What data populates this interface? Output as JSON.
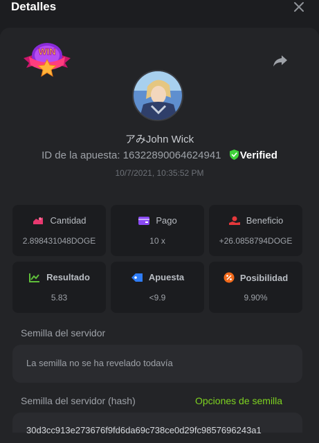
{
  "header": {
    "title": "Detalles"
  },
  "icons": {
    "close": "close-icon",
    "share": "share-icon",
    "logo": "win-badge-icon"
  },
  "logo_text": "WIN",
  "user": {
    "name": "アみJohn Wick",
    "bet_id_label": "ID de la apuesta: 1632289006462494​1",
    "verified": "Verified",
    "timestamp": "10/7/2021, 10:35:52 PM"
  },
  "stats": [
    {
      "label": "Cantidad",
      "value": "2.898431048DOGE",
      "icon": "cantidad-icon",
      "color": "#e8386f"
    },
    {
      "label": "Pago",
      "value": "10 x",
      "icon": "wallet-icon",
      "color": "#8a4af3"
    },
    {
      "label": "Beneficio",
      "value": "+26.0858794DOGE",
      "icon": "beneficio-icon",
      "color": "#e5383b"
    },
    {
      "label": "Resultado",
      "value": "5.83",
      "icon": "resultado-icon",
      "color": "#5fbf3a"
    },
    {
      "label": "Apuesta",
      "value": "<9.9",
      "icon": "tag-icon",
      "color": "#2e7cf6"
    },
    {
      "label": "Posibilidad",
      "value": "9.90%",
      "icon": "percent-icon",
      "color": "#f26a1b"
    }
  ],
  "server_seed": {
    "label": "Semilla del servidor",
    "value": "La semilla no se ha revelado todavía"
  },
  "server_seed_hash": {
    "label": "Semilla del servidor (hash)",
    "options_link": "Opciones de semilla",
    "value": "30d3cc913e273676f9fd6da69c738ce0d29fc9857696243a1"
  },
  "colors": {
    "accent_green": "#7ed321",
    "verified_green": "#3fd13a"
  }
}
